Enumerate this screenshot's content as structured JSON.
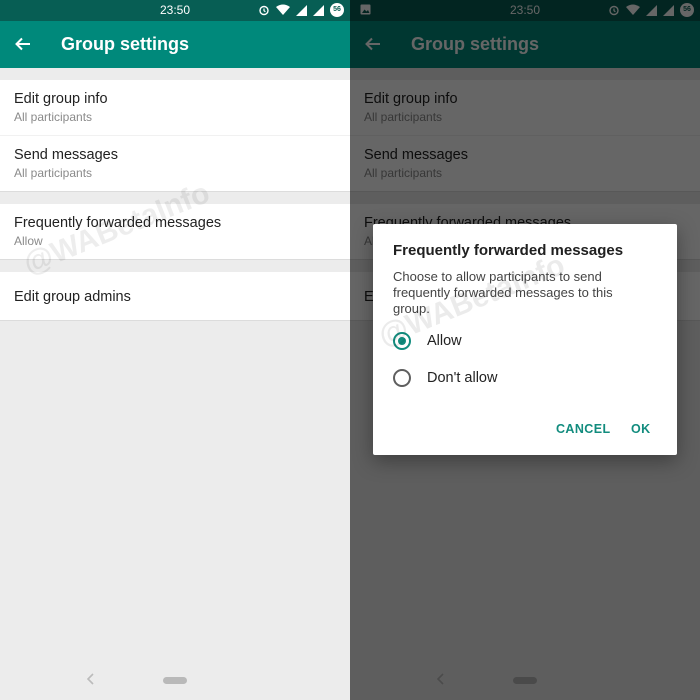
{
  "status_bar": {
    "time": "23:50",
    "battery_level": "56"
  },
  "app_bar": {
    "title": "Group settings"
  },
  "settings": {
    "group1": [
      {
        "primary": "Edit group info",
        "secondary": "All participants"
      },
      {
        "primary": "Send messages",
        "secondary": "All participants"
      }
    ],
    "group2": [
      {
        "primary": "Frequently forwarded messages",
        "secondary": "Allow"
      }
    ],
    "group3": [
      {
        "primary": "Edit group admins"
      }
    ]
  },
  "dialog": {
    "title": "Frequently forwarded messages",
    "message": "Choose to allow participants to send frequently forwarded messages to this group.",
    "options": [
      {
        "label": "Allow",
        "selected": true
      },
      {
        "label": "Don't allow",
        "selected": false
      }
    ],
    "cancel_label": "CANCEL",
    "ok_label": "OK"
  },
  "watermark": "@WABetaInfo",
  "colors": {
    "status_bar": "#075e54",
    "app_bar": "#00897b",
    "accent": "#128c7e",
    "background": "#ececec"
  },
  "icons": [
    "arrow-back-icon",
    "alarm-icon",
    "wifi-icon",
    "signal-icon",
    "image-icon",
    "nav-back-icon"
  ]
}
